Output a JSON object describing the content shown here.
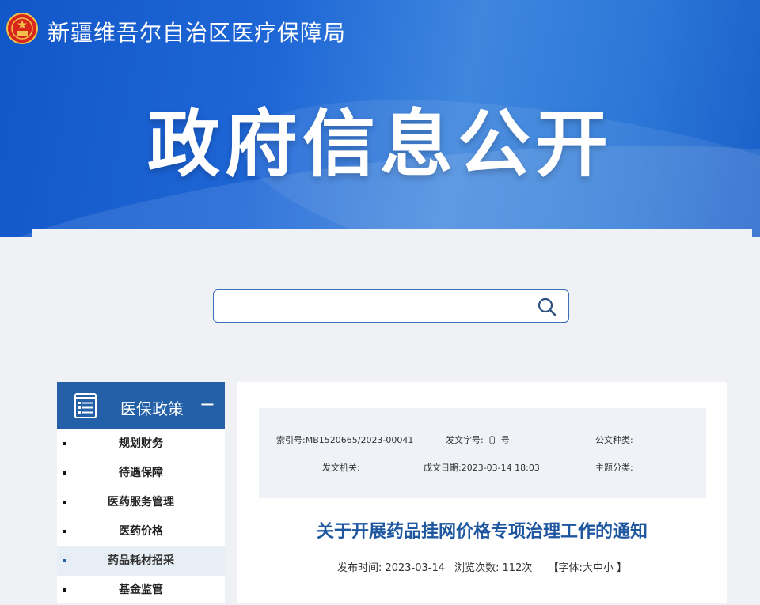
{
  "header": {
    "site_title": "新疆维吾尔自治区医疗保障局",
    "hero_title": "政府信息公开"
  },
  "search": {
    "placeholder": ""
  },
  "sidebar": {
    "heading": "医保政策",
    "collapse_symbol": "−",
    "items": [
      {
        "label": "规划财务"
      },
      {
        "label": "待遇保障"
      },
      {
        "label": "医药服务管理"
      },
      {
        "label": "医药价格"
      },
      {
        "label": "药品耗材招采"
      },
      {
        "label": "基金监管"
      }
    ],
    "active_index": 4
  },
  "meta": {
    "index_label": "索引号:",
    "index_value": "MB1520665/2023-00041",
    "doc_no_label": "发文字号:",
    "doc_no_value": "〔〕号",
    "doc_type_label": "公文种类:",
    "issuer_label": "发文机关:",
    "created_label": "成文日期:",
    "created_value": "2023-03-14 18:03",
    "topic_label": "主题分类:"
  },
  "article": {
    "title": "关于开展药品挂网价格专项治理工作的通知",
    "publish_label": "发布时间:",
    "publish_date": "2023-03-14",
    "views_label": "浏览次数:",
    "views_value": "112次",
    "font_open": "【字体:",
    "font_large": "大",
    "font_medium": "中",
    "font_small": "小",
    "font_close": "】"
  },
  "colors": {
    "banner_primary": "#1e66d6",
    "sidebar_head": "#2460a8",
    "title_blue": "#1e56a0"
  }
}
